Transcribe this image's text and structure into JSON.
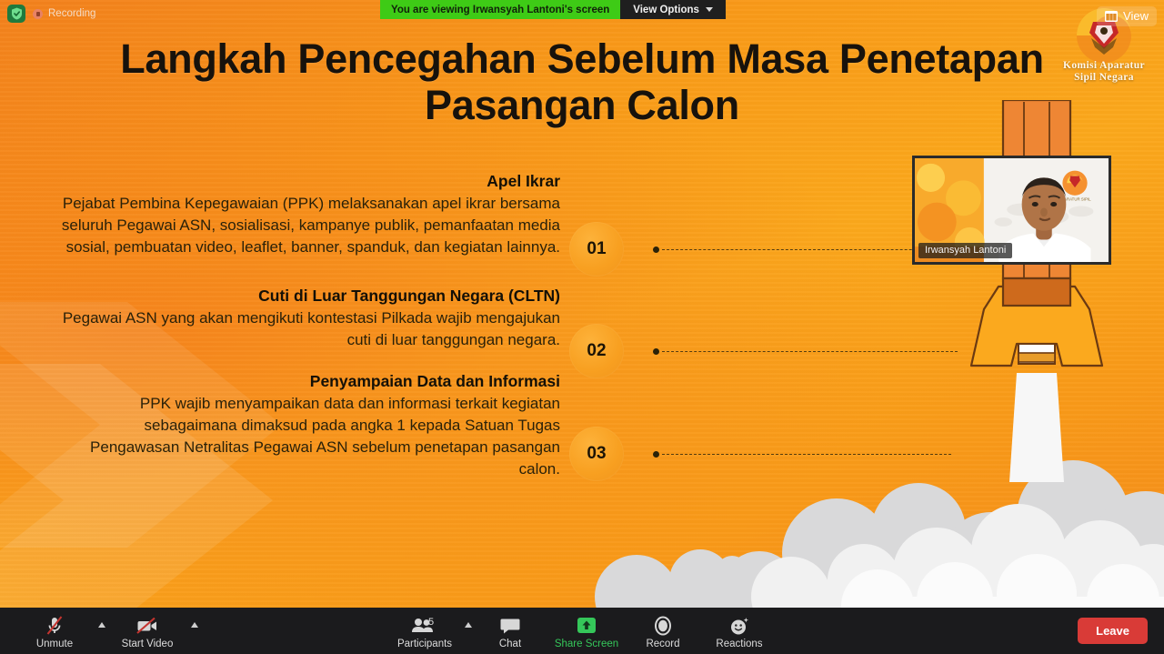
{
  "zoom_ui": {
    "recording_label": "Recording",
    "shield_icon": "security-shield-icon",
    "recording_icon": "recording-pause-icon",
    "viewing_banner": "You are viewing Irwansyah Lantoni's screen",
    "view_options_label": "View Options",
    "view_button_label": "View",
    "view_button_icon": "layout-grid-icon",
    "participant_thumb_name": "Irwansyah Lantoni",
    "colors": {
      "banner_green": "#3ecb16",
      "toolbar_bg": "#1b1b1d",
      "leave_red": "#d93b37",
      "share_green": "#35c75a"
    }
  },
  "toolbar": {
    "items": [
      {
        "label": "Unmute",
        "icon": "microphone-muted-icon",
        "caret": true,
        "accent": false
      },
      {
        "label": "Start Video",
        "icon": "video-muted-icon",
        "caret": true,
        "accent": false
      },
      {
        "label": "Participants",
        "icon": "participants-icon",
        "caret": true,
        "accent": false,
        "count": "5"
      },
      {
        "label": "Chat",
        "icon": "chat-bubble-icon",
        "caret": false,
        "accent": false
      },
      {
        "label": "Share Screen",
        "icon": "share-screen-icon",
        "caret": false,
        "accent": true
      },
      {
        "label": "Record",
        "icon": "record-circle-icon",
        "caret": false,
        "accent": false
      },
      {
        "label": "Reactions",
        "icon": "reactions-smiley-icon",
        "caret": false,
        "accent": false
      }
    ],
    "leave_label": "Leave"
  },
  "slide": {
    "title": "Langkah Pencegahan Sebelum Masa Penetapan Pasangan Calon",
    "logo": {
      "line1": "Komisi Aparatur",
      "line2": "Sipil Negara",
      "emblem": "garuda-pancasila-icon"
    },
    "blocks": [
      {
        "number": "01",
        "title": "Apel Ikrar",
        "body": "Pejabat Pembina Kepegawaian (PPK) melaksanakan apel ikrar bersama seluruh Pegawai ASN, sosialisasi, kampanye publik, pemanfaatan media sosial, pembuatan video, leaflet, banner, spanduk, dan kegiatan lainnya."
      },
      {
        "number": "02",
        "title": "Cuti di Luar Tanggungan Negara (CLTN)",
        "body": "Pegawai ASN yang akan mengikuti kontestasi Pilkada wajib mengajukan cuti di luar tanggungan negara."
      },
      {
        "number": "03",
        "title": "Penyampaian Data dan Informasi",
        "body": "PPK wajib menyampaikan data dan informasi terkait kegiatan sebagaimana dimaksud pada angka 1 kepada Satuan Tugas Pengawasan Netralitas Pegawai ASN sebelum penetapan pasangan calon."
      }
    ],
    "illustration": {
      "rocket": "rocket-launch-icon",
      "smoke": "smoke-cloud-icon"
    },
    "colors": {
      "background_orange": "#F9A318",
      "accent_deep_orange": "#F3801C",
      "marker_circle": "#F8A021",
      "text_dark": "#17120c"
    }
  }
}
